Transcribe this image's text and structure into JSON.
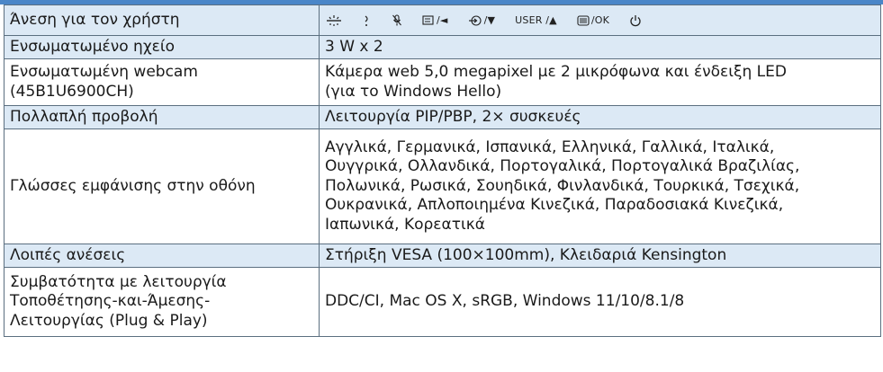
{
  "colors": {
    "shaded_row": "#dce9f5",
    "border": "#5b6f80",
    "header_bar": "#4a86c8"
  },
  "rows": [
    {
      "label": "Άνεση για τον χρήστη",
      "value": "",
      "shaded": true
    },
    {
      "label": "Ενσωματωμένο ηχείο",
      "value": "3 W x 2",
      "shaded": true
    },
    {
      "label": "Ενσωματωμένη webcam\n(45B1U6900CH)",
      "value": "Κάμερα web 5,0 megapixel με 2 μικρόφωνα και ένδειξη LED\n(για το Windows Hello)",
      "shaded": false
    },
    {
      "label": "Πολλαπλή προβολή",
      "value": "Λειτουργία PIP/PBP, 2× συσκευές",
      "shaded": true
    },
    {
      "label": "Γλώσσες εμφάνισης στην οθόνη",
      "value": "Αγγλικά, Γερμανικά, Ισπανικά, Ελληνικά, Γαλλικά, Ιταλικά,\nΟυγγρικά, Ολλανδικά, Πορτογαλικά, Πορτογαλικά Βραζιλίας,\nΠολωνικά, Ρωσικά, Σουηδικά, Φινλανδικά, Τουρκικά, Τσεχικά,\nΟυκρανικά, Απλοποιημένα Κινεζικά, Παραδοσιακά Κινεζικά,\nΙαπωνικά, Κορεατικά",
      "shaded": false
    },
    {
      "label": "Λοιπές ανέσεις",
      "value": "Στήριξη VESA (100×100mm), Κλειδαριά Kensington",
      "shaded": true
    },
    {
      "label": "Συμβατότητα με λειτουργία\nΤοποθέτησης-και-Άμεσης-\nΛειτουργίας (Plug & Play)",
      "value": "DDC/CI, Mac OS X, sRGB, Windows 11/10/8.1/8",
      "shaded": false
    }
  ],
  "controls": [
    {
      "icon": "brightness-icon",
      "text": ""
    },
    {
      "icon": "power-sensor-icon",
      "text": ""
    },
    {
      "icon": "mic-mute-icon",
      "text": ""
    },
    {
      "icon": "input-menu-icon",
      "text": "/◄"
    },
    {
      "icon": "input-source-icon",
      "text": "/▼"
    },
    {
      "icon": "user-key-icon",
      "text": "USER /▲"
    },
    {
      "icon": "menu-icon",
      "text": "/OK"
    },
    {
      "icon": "power-icon",
      "text": ""
    }
  ]
}
